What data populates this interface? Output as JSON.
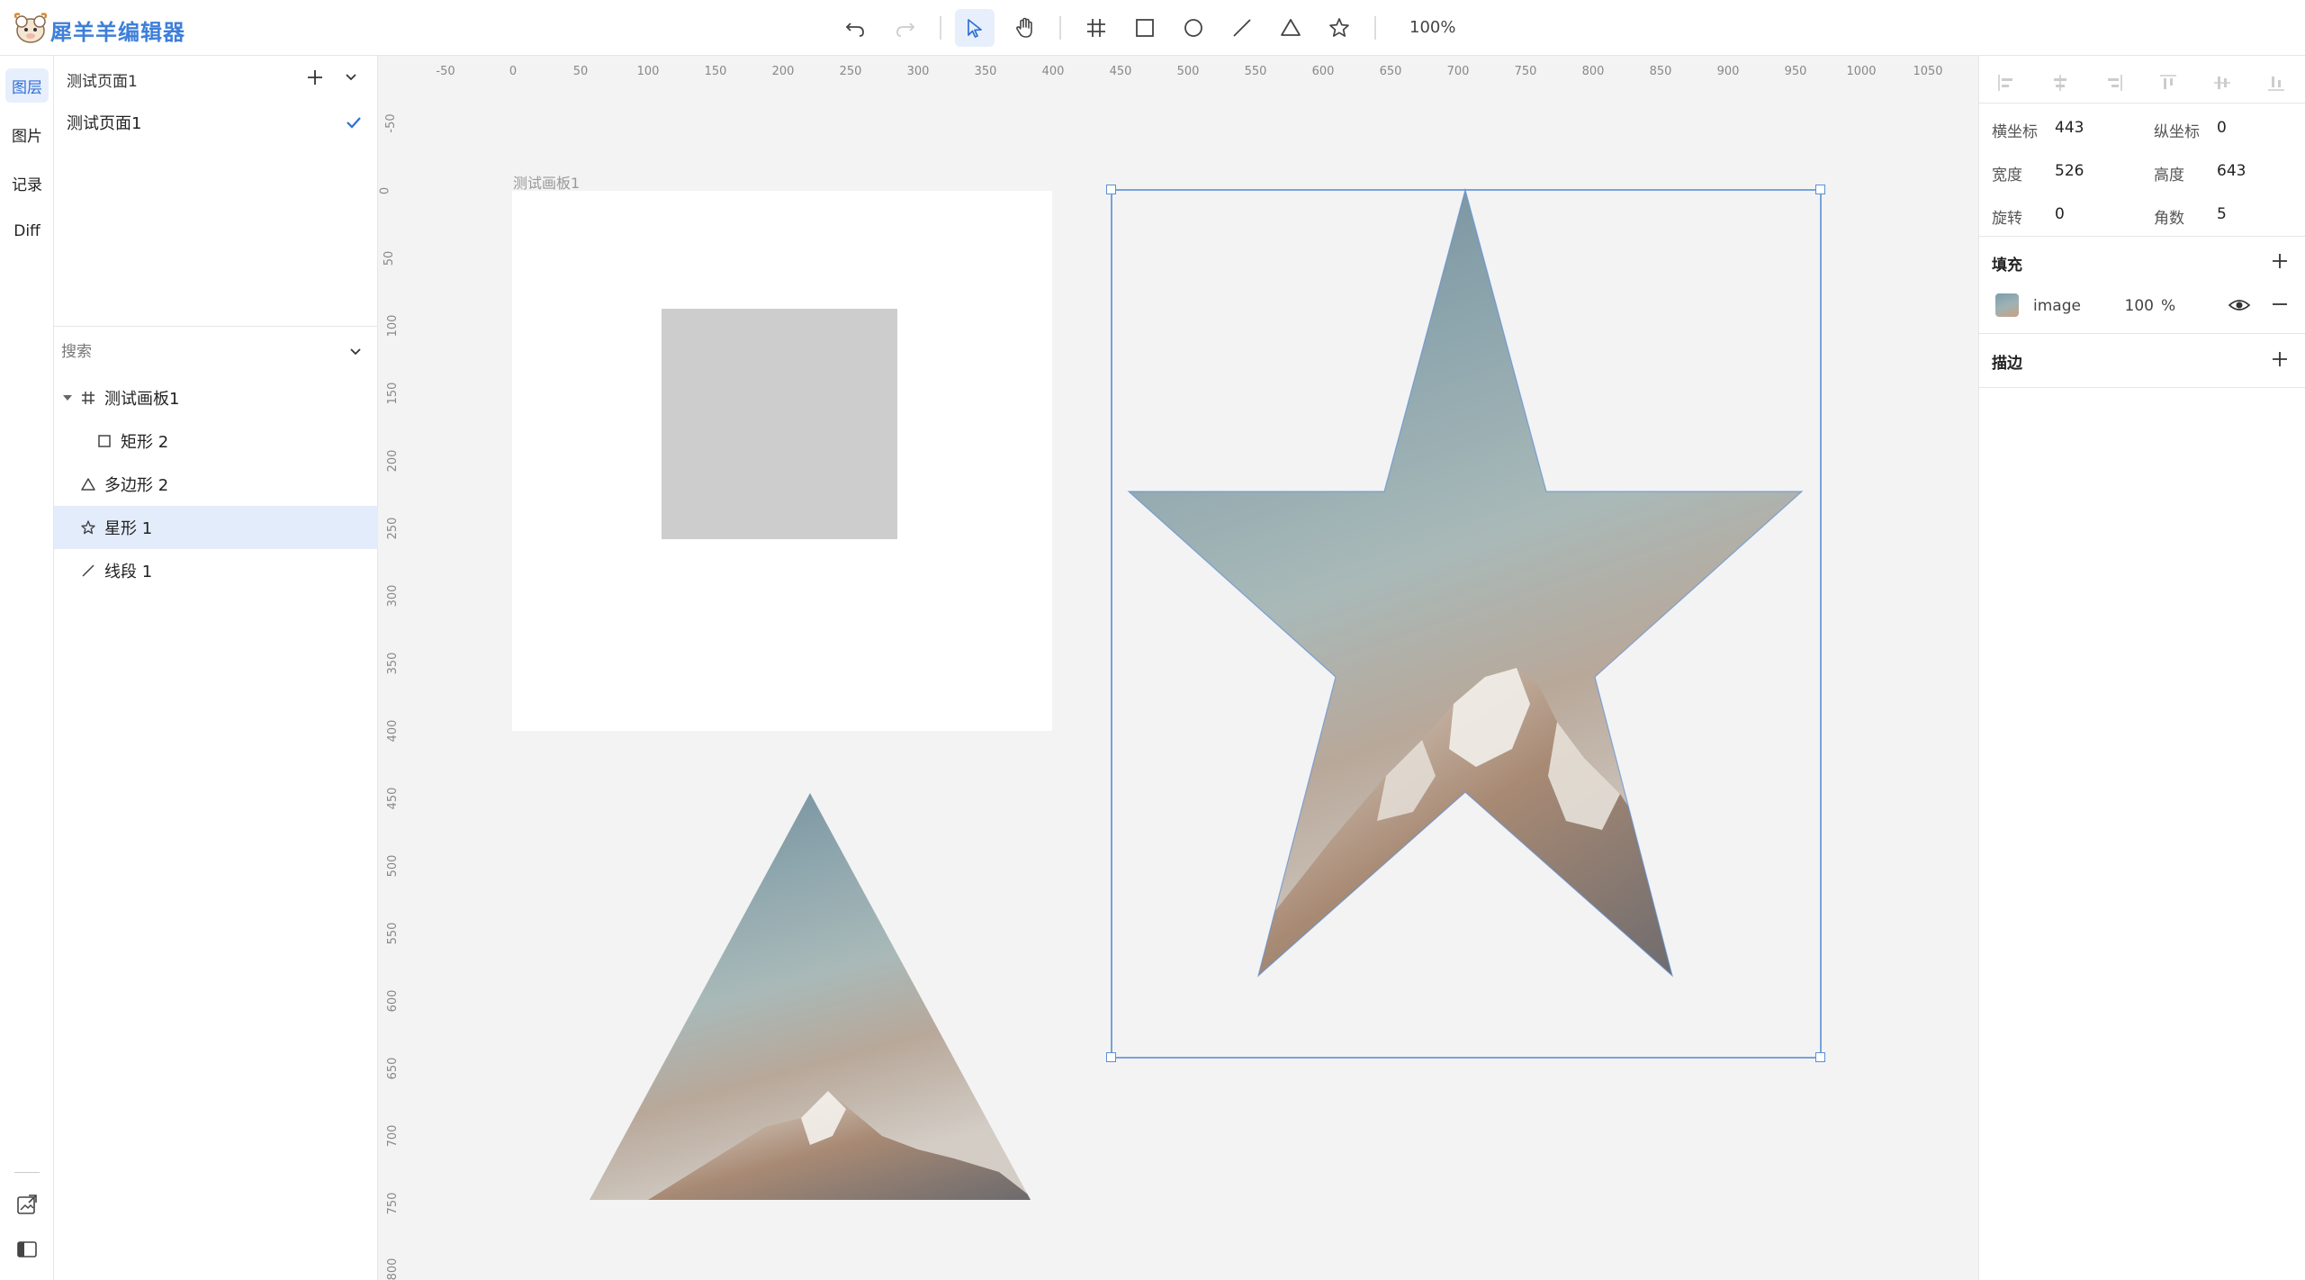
{
  "app": {
    "title": "犀羊羊编辑器",
    "logo_icon": "sheep-logo-icon"
  },
  "toolbar": {
    "tools": [
      {
        "name": "undo",
        "icon": "undo-icon",
        "enabled": true
      },
      {
        "name": "redo",
        "icon": "redo-icon",
        "enabled": false
      },
      {
        "name": "select",
        "icon": "cursor-icon",
        "active": true
      },
      {
        "name": "hand",
        "icon": "hand-icon"
      },
      {
        "name": "frame",
        "icon": "frame-icon"
      },
      {
        "name": "rectangle",
        "icon": "rectangle-icon"
      },
      {
        "name": "ellipse",
        "icon": "ellipse-icon"
      },
      {
        "name": "line",
        "icon": "line-icon"
      },
      {
        "name": "polygon",
        "icon": "triangle-icon"
      },
      {
        "name": "star",
        "icon": "star-icon"
      }
    ],
    "zoom": "100%"
  },
  "rail": {
    "items": [
      {
        "label": "图层",
        "active": true
      },
      {
        "label": "图片"
      },
      {
        "label": "记录"
      },
      {
        "label": "Diff"
      }
    ],
    "bottom_icons": [
      "export-image-icon",
      "sidebar-toggle-icon"
    ]
  },
  "pages": {
    "header_title": "测试页面1",
    "list": [
      {
        "label": "测试页面1",
        "checked": true
      }
    ]
  },
  "layers": {
    "search_placeholder": "搜索",
    "tree": [
      {
        "label": "测试画板1",
        "icon": "frame-icon",
        "expanded": true,
        "depth": 0
      },
      {
        "label": "矩形 2",
        "icon": "rectangle-icon",
        "depth": 1
      },
      {
        "label": "多边形 2",
        "icon": "triangle-icon",
        "depth": 0
      },
      {
        "label": "星形 1",
        "icon": "star-icon",
        "depth": 0,
        "selected": true
      },
      {
        "label": "线段 1",
        "icon": "line-icon",
        "depth": 0
      }
    ]
  },
  "canvas": {
    "background": "#f3f3f3",
    "ruler_x_labels": [
      "-50",
      "0",
      "50",
      "100",
      "150",
      "200",
      "250",
      "300",
      "350",
      "400",
      "450",
      "500",
      "550",
      "600",
      "650",
      "700",
      "750",
      "800",
      "850",
      "900",
      "950",
      "1000",
      "1050"
    ],
    "ruler_y_labels": [
      "-50",
      "0",
      "50",
      "100",
      "150",
      "200",
      "250",
      "300",
      "350",
      "400",
      "450",
      "500",
      "550",
      "600",
      "650",
      "700",
      "750",
      "800"
    ],
    "artboard_label": "测试画板1",
    "selection_color": "#5b8fd6"
  },
  "properties": {
    "x_label": "横坐标",
    "x_value": "443",
    "y_label": "纵坐标",
    "y_value": "0",
    "w_label": "宽度",
    "w_value": "526",
    "h_label": "高度",
    "h_value": "643",
    "rotation_label": "旋转",
    "rotation_value": "0",
    "corners_label": "角数",
    "corners_value": "5",
    "fill_title": "填充",
    "fill": {
      "type": "image",
      "opacity": "100",
      "unit": "%"
    },
    "stroke_title": "描边"
  }
}
